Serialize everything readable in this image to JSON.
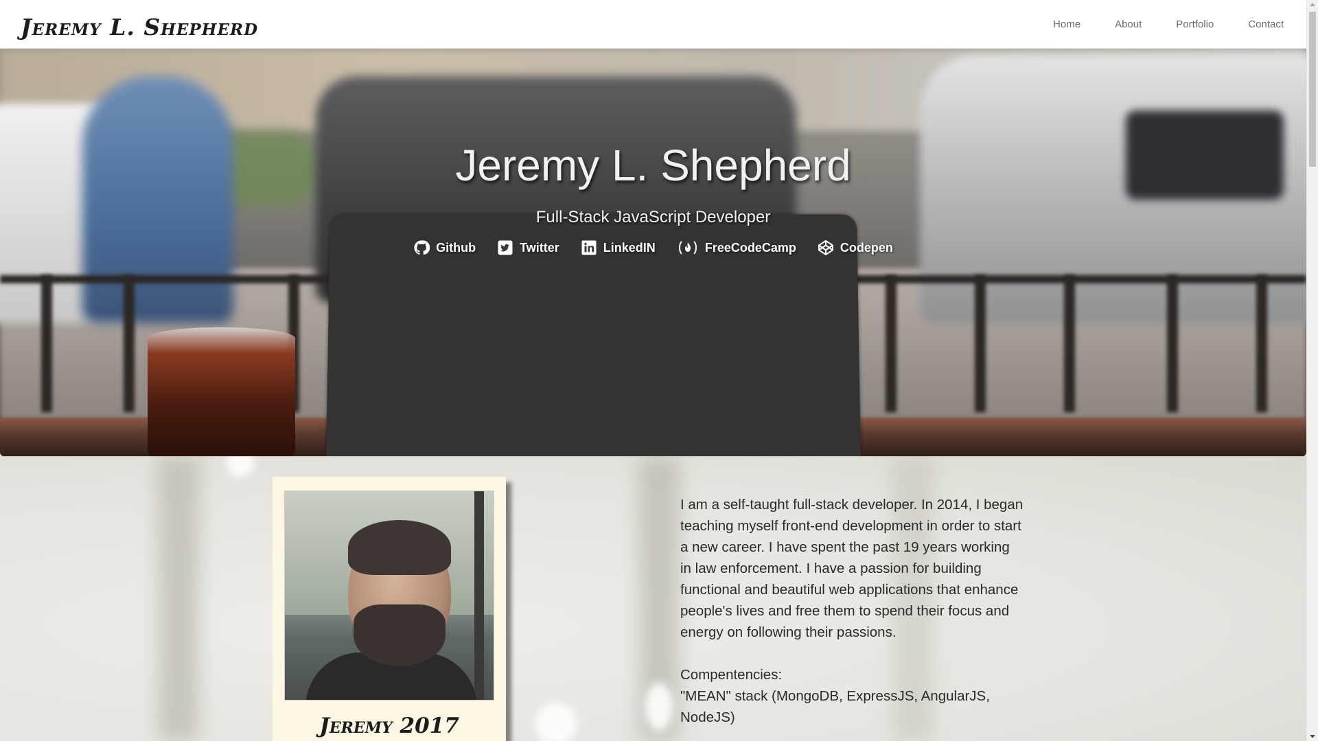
{
  "navbar": {
    "brand": "Jeremy L. Shepherd",
    "items": [
      {
        "label": "Home"
      },
      {
        "label": "About"
      },
      {
        "label": "Portfolio"
      },
      {
        "label": "Contact"
      }
    ]
  },
  "hero": {
    "title": "Jeremy L. Shepherd",
    "subtitle": "Full-Stack JavaScript Developer",
    "social": [
      {
        "label": "Github",
        "icon": "github-icon"
      },
      {
        "label": "Twitter",
        "icon": "twitter-icon"
      },
      {
        "label": "LinkedIN",
        "icon": "linkedin-icon"
      },
      {
        "label": "FreeCodeCamp",
        "icon": "freecodecamp-icon"
      },
      {
        "label": "Codepen",
        "icon": "codepen-icon"
      }
    ]
  },
  "about": {
    "photo_caption": "Jeremy 2017",
    "bio": "I am a self-taught full-stack developer. In 2014, I began teaching myself front-end development in order to start a new career. I have spent the past 19 years working in law enforcement. I have a passion for building functional and beautiful web applications that enhance people's lives and free them to spend their focus and energy on following their passions.",
    "competencies_heading": "Compentencies:",
    "competencies_line": "\"MEAN\" stack (MongoDB, ExpressJS, AngularJS, NodeJS)"
  },
  "colors": {
    "nav_text": "#6a6a6a",
    "hero_text": "#f2f2f2",
    "polaroid_bg": "#fbf7e3"
  }
}
